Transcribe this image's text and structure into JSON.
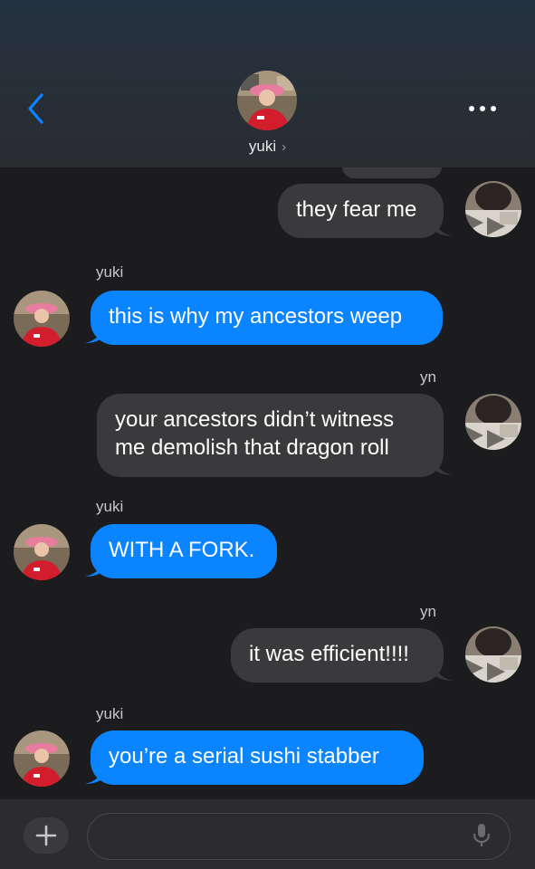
{
  "header": {
    "contact_name": "yuki",
    "chevron": "›"
  },
  "messages": [
    {
      "side": "me",
      "text": "they fear me"
    },
    {
      "side": "them",
      "sender": "yuki",
      "text": "this is why my ancestors weep"
    },
    {
      "side": "me",
      "sender": "yn",
      "lines": [
        "your ancestors didn’t witness",
        "me demolish that dragon roll"
      ]
    },
    {
      "side": "them",
      "sender": "yuki",
      "text": "WITH A FORK."
    },
    {
      "side": "me",
      "sender": "yn",
      "text": "it was efficient!!!!"
    },
    {
      "side": "them",
      "sender": "yuki",
      "text": "you’re a serial sushi stabber"
    }
  ],
  "colors": {
    "background": "#1c1c1e",
    "incoming_bubble": "#0a84ff",
    "outgoing_bubble": "#3a3a3c",
    "accent": "#0a84ff"
  },
  "icons": {
    "back": "chevron-left-icon",
    "more": "ellipsis-icon",
    "plus": "plus-icon",
    "mic": "mic-icon"
  }
}
